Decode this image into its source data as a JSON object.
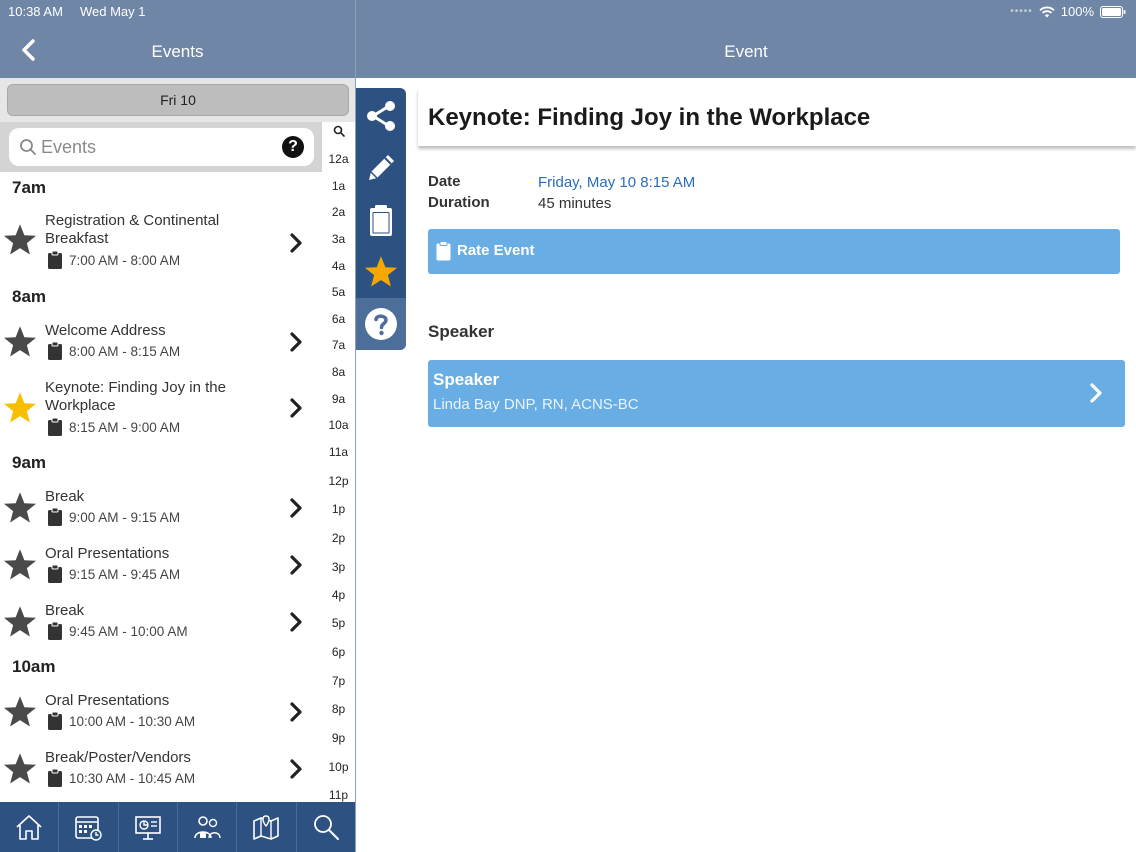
{
  "status": {
    "time": "10:38 AM",
    "date": "Wed May 1",
    "battery": "100%"
  },
  "left_header": {
    "title": "Events"
  },
  "right_header": {
    "title": "Event"
  },
  "date_selector": {
    "label": "Fri 10"
  },
  "search": {
    "placeholder": "Events"
  },
  "sections": [
    {
      "label": "7am"
    },
    {
      "label": "8am"
    },
    {
      "label": "9am"
    },
    {
      "label": "10am"
    }
  ],
  "events": [
    {
      "title": "Registration & Continental Breakfast",
      "time": "7:00 AM - 8:00 AM",
      "favorite": false
    },
    {
      "title": "Welcome Address",
      "time": "8:00 AM - 8:15 AM",
      "favorite": false
    },
    {
      "title": "Keynote: Finding Joy in the Workplace",
      "time": "8:15 AM - 9:00 AM",
      "favorite": true
    },
    {
      "title": "Break",
      "time": "9:00 AM - 9:15 AM",
      "favorite": false
    },
    {
      "title": "Oral Presentations",
      "time": "9:15 AM - 9:45 AM",
      "favorite": false
    },
    {
      "title": "Break",
      "time": "9:45 AM - 10:00 AM",
      "favorite": false
    },
    {
      "title": "Oral Presentations",
      "time": "10:00 AM - 10:30 AM",
      "favorite": false
    },
    {
      "title": "Break/Poster/Vendors",
      "time": "10:30 AM - 10:45 AM",
      "favorite": false
    }
  ],
  "hour_index": [
    "12a",
    "1a",
    "2a",
    "3a",
    "4a",
    "5a",
    "6a",
    "7a",
    "8a",
    "9a",
    "10a",
    "11a",
    "12p",
    "1p",
    "2p",
    "3p",
    "4p",
    "5p",
    "6p",
    "7p",
    "8p",
    "9p",
    "10p",
    "11p"
  ],
  "detail": {
    "title": "Keynote: Finding Joy in the Workplace",
    "date_label": "Date",
    "date_value": "Friday, May 10 8:15 AM",
    "duration_label": "Duration",
    "duration_value": "45 minutes",
    "rate_button": "Rate Event",
    "speaker_heading": "Speaker",
    "speaker_card_title": "Speaker",
    "speaker_name": "Linda Bay DNP, RN, ACNS-BC"
  },
  "tabs": [
    {
      "icon": "home-icon"
    },
    {
      "icon": "calendar-icon"
    },
    {
      "icon": "presentation-icon"
    },
    {
      "icon": "people-icon"
    },
    {
      "icon": "map-icon"
    },
    {
      "icon": "search-icon"
    }
  ],
  "colors": {
    "header": "#6f86a7",
    "toolbar": "#2d5282",
    "accent_blue": "#68ade3",
    "link": "#2a6cc0",
    "star_gold": "#f6c000",
    "star_gray": "#4a4a4a"
  }
}
